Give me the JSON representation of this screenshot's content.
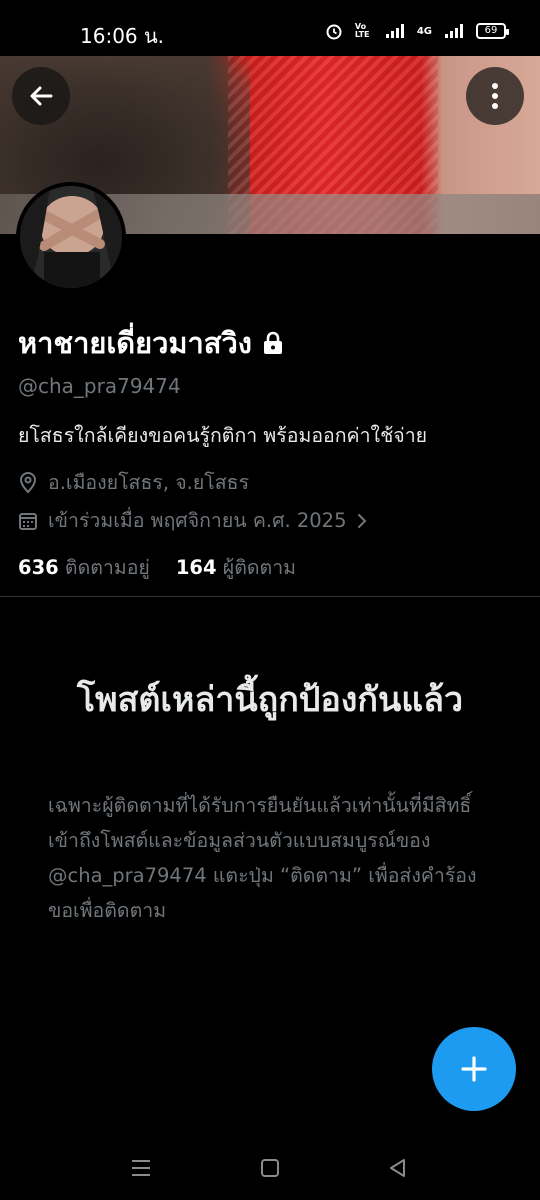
{
  "status_bar": {
    "time": "16:06 น.",
    "network": "4G",
    "volte": "Vo LTE",
    "battery": "69"
  },
  "profile": {
    "name": "หาชายเดี่ยวมาสวิง",
    "handle": "@cha_pra79474",
    "bio": "ยโสธรใกล้เคียงขอคนรู้กติกา พร้อมออกค่าใช้จ่าย",
    "location": "อ.เมืองยโสธร, จ.ยโสธร",
    "joined": "เข้าร่วมเมื่อ พฤศจิกายน ค.ศ. 2025",
    "following_count": "636",
    "following_label": "ติดตามอยู่",
    "followers_count": "164",
    "followers_label": "ผู้ติดตาม"
  },
  "protected": {
    "title": "โพสต์เหล่านี้ถูกป้องกันแล้ว",
    "description": "เฉพาะผู้ติดตามที่ได้รับการยืนยันแล้วเท่านั้นที่มีสิทธิ์เข้าถึงโพสต์และข้อมูลส่วนตัวแบบสมบูรณ์ของ @cha_pra79474 แตะปุ่ม “ติดตาม” เพื่อส่งคำร้องขอเพื่อติดตาม"
  },
  "icons": {
    "back": "arrow-left-icon",
    "more": "more-vertical-icon",
    "lock": "lock-icon",
    "location": "location-pin-icon",
    "calendar": "calendar-icon",
    "compose": "plus-icon"
  },
  "colors": {
    "accent": "#1d9bf0",
    "secondary_text": "#71767b",
    "background": "#000000"
  }
}
